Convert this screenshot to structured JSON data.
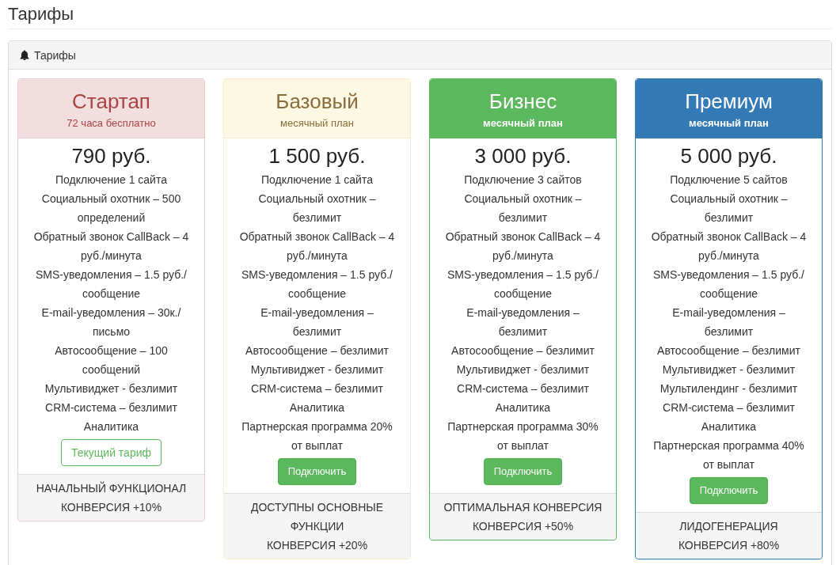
{
  "page_title": "Тарифы",
  "panel": {
    "title": "Тарифы"
  },
  "plans": [
    {
      "kind": "danger",
      "name": "Стартап",
      "subtitle": "72 часа бесплатно",
      "price": "790 руб.",
      "features": [
        "Подключение 1 сайта",
        "Социальный охотник – 500 определений",
        "Обратный звонок CallBack – 4 руб./минута",
        "SMS-уведомления – 1.5 руб./ сообщение",
        "E-mail-уведомления – 30к./ письмо",
        "Автосообщение – 100 сообщений",
        "Мультивиджет - безлимит",
        "CRM-система – безлимит",
        "Аналитика"
      ],
      "button": {
        "kind": "current",
        "label": "Текущий тариф"
      },
      "footer": [
        "НАЧАЛЬНЫЙ ФУНКЦИОНАЛ",
        "КОНВЕРСИЯ +10%"
      ]
    },
    {
      "kind": "warning",
      "name": "Базовый",
      "subtitle": "месячный план",
      "price": "1 500 руб.",
      "features": [
        "Подключение 1 сайта",
        "Социальный охотник – безлимит",
        "Обратный звонок CallBack – 4 руб./минута",
        "SMS-уведомления – 1.5 руб./ сообщение",
        "E-mail-уведомления – безлимит",
        "Автосообщение – безлимит",
        "Мультивиджет - безлимит",
        "CRM-система – безлимит",
        "Аналитика",
        "Партнерская программа 20% от выплат"
      ],
      "button": {
        "kind": "subscribe",
        "label": "Подключить"
      },
      "footer": [
        "ДОСТУПНЫ ОСНОВНЫЕ ФУНКЦИИ",
        "КОНВЕРСИЯ +20%"
      ]
    },
    {
      "kind": "success",
      "name": "Бизнес",
      "subtitle": "месячный план",
      "price": "3 000 руб.",
      "features": [
        "Подключение 3 сайтов",
        "Социальный охотник – безлимит",
        "Обратный звонок CallBack – 4 руб./минута",
        "SMS-уведомления – 1.5 руб./ сообщение",
        "E-mail-уведомления – безлимит",
        "Автосообщение – безлимит",
        "Мультивиджет - безлимит",
        "CRM-система – безлимит",
        "Аналитика",
        "Партнерская программа 30% от выплат"
      ],
      "button": {
        "kind": "subscribe",
        "label": "Подключить"
      },
      "footer": [
        "ОПТИМАЛЬНАЯ КОНВЕРСИЯ",
        "КОНВЕРСИЯ +50%"
      ]
    },
    {
      "kind": "primary",
      "name": "Премиум",
      "subtitle": "месячный план",
      "price": "5 000 руб.",
      "features": [
        "Подключение 5 сайтов",
        "Социальный охотник – безлимит",
        "Обратный звонок CallBack – 4 руб./минута",
        "SMS-уведомления – 1.5 руб./ сообщение",
        "E-mail-уведомления – безлимит",
        "Автосообщение – безлимит",
        "Мультивиджет - безлимит",
        "Мультилендинг - безлимит",
        "CRM-система – безлимит",
        "Аналитика",
        "Партнерская программа 40% от выплат"
      ],
      "button": {
        "kind": "subscribe",
        "label": "Подключить"
      },
      "footer": [
        "ЛИДОГЕНЕРАЦИЯ",
        "КОНВЕРСИЯ +80%"
      ]
    }
  ]
}
